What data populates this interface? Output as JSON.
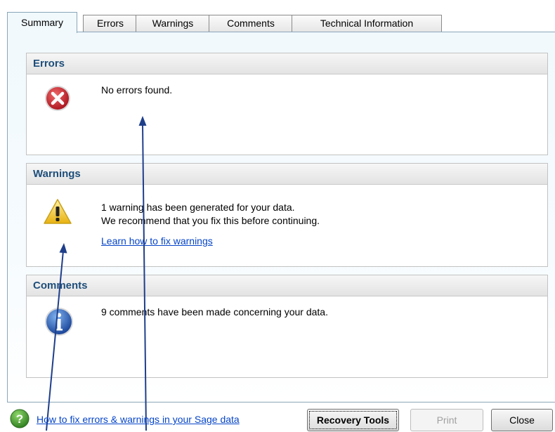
{
  "tabs": [
    {
      "label": "Summary",
      "active": true
    },
    {
      "label": "Errors"
    },
    {
      "label": "Warnings"
    },
    {
      "label": "Comments"
    },
    {
      "label": "Technical Information"
    }
  ],
  "sections": {
    "errors": {
      "title": "Errors",
      "icon": "error-icon",
      "message": "No errors found."
    },
    "warnings": {
      "title": "Warnings",
      "icon": "warning-icon",
      "message_line1": "1 warning has been generated for your data.",
      "message_line2": "We recommend that you fix this before continuing.",
      "link": "Learn how to fix warnings"
    },
    "comments": {
      "title": "Comments",
      "icon": "info-icon",
      "message": "9 comments have been made concerning your data."
    }
  },
  "footer": {
    "help_icon": "question-icon",
    "help_link": "How to fix errors & warnings in your Sage data",
    "recovery_button": "Recovery Tools",
    "print_button": "Print",
    "close_button": "Close"
  },
  "colors": {
    "section_title": "#1e4e7a",
    "link": "#0645c8",
    "error_red": "#c8202a",
    "warning_yellow": "#f3c623",
    "info_blue": "#1e5db8",
    "help_green": "#3a9a2a",
    "arrow": "#1f3f8a"
  }
}
